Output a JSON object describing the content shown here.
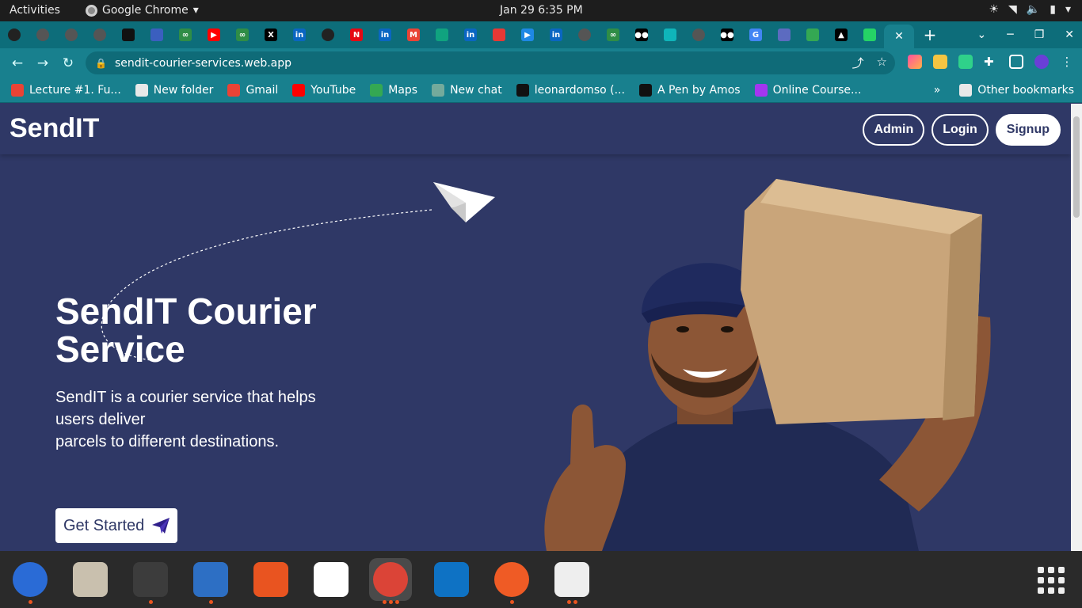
{
  "system": {
    "activities": "Activities",
    "app_name": "Google Chrome",
    "clock": "Jan 29   6:35 PM"
  },
  "browser": {
    "url": "sendit-courier-services.web.app",
    "tab_icons": [
      "github",
      "globe",
      "globe",
      "globe",
      "hexagon",
      "firefox-globe",
      "gfg",
      "youtube",
      "gfg",
      "x",
      "linkedin",
      "github",
      "netflix",
      "linkedin",
      "gmail",
      "chatgpt",
      "linkedin",
      "record",
      "play",
      "linkedin",
      "globe",
      "gfg",
      "medium",
      "diamond",
      "globe",
      "medium",
      "google",
      "loader",
      "drive",
      "vercel",
      "whatsapp"
    ],
    "bookmarks": [
      {
        "label": "Lecture #1. Fu...",
        "icon": "lecture-icon",
        "color": "#ea4335"
      },
      {
        "label": "New folder",
        "icon": "folder-icon",
        "color": "#e8e8e8"
      },
      {
        "label": "Gmail",
        "icon": "gmail-icon",
        "color": "#ea4335"
      },
      {
        "label": "YouTube",
        "icon": "youtube-icon",
        "color": "#ff0000"
      },
      {
        "label": "Maps",
        "icon": "maps-icon",
        "color": "#34a853"
      },
      {
        "label": "New chat",
        "icon": "chat-icon",
        "color": "#74aa9c"
      },
      {
        "label": "leonardomso (...",
        "icon": "github-icon",
        "color": "#111111"
      },
      {
        "label": "A Pen by Amos",
        "icon": "codepen-icon",
        "color": "#111111"
      },
      {
        "label": "Online Course...",
        "icon": "course-icon",
        "color": "#a435f0"
      }
    ],
    "other_bookmarks": "Other bookmarks",
    "more": "»"
  },
  "site": {
    "brand": "SendIT",
    "nav": {
      "admin": "Admin",
      "login": "Login",
      "signup": "Signup"
    },
    "hero_title": "SendIT Courier Service",
    "hero_text_1": "SendIT is a courier service that helps users deliver",
    "hero_text_2": "parcels to different destinations.",
    "cta": "Get Started",
    "colors": {
      "background": "#2f3866",
      "accent": "#ffffff"
    }
  },
  "dock": {
    "apps": [
      {
        "name": "thunderbird-icon",
        "color": "#2a6bd6"
      },
      {
        "name": "files-icon",
        "color": "#c9c0ae"
      },
      {
        "name": "terminal-icon",
        "color": "#3c3c3c"
      },
      {
        "name": "writer-icon",
        "color": "#2d6fc4"
      },
      {
        "name": "software-icon",
        "color": "#e95420"
      },
      {
        "name": "slack-icon",
        "color": "#ffffff"
      },
      {
        "name": "chrome-icon",
        "color": "#db4437"
      },
      {
        "name": "vscode-icon",
        "color": "#0e72c4"
      },
      {
        "name": "postman-icon",
        "color": "#ef5b25"
      },
      {
        "name": "reader-icon",
        "color": "#eeeeee"
      }
    ]
  }
}
